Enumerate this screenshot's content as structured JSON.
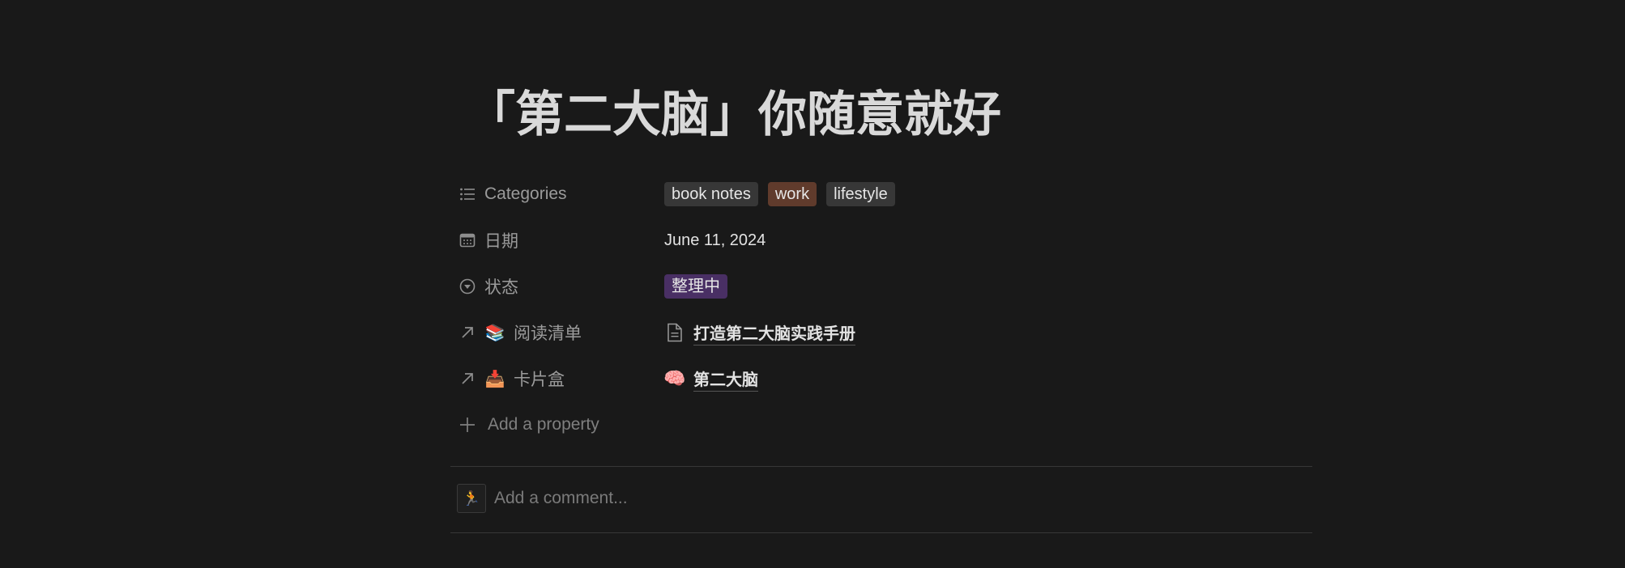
{
  "page": {
    "title": "「第二大脑」你随意就好"
  },
  "properties": {
    "categories": {
      "label": "Categories",
      "icon": "list-icon",
      "tags": [
        {
          "label": "book notes",
          "color": "#373737"
        },
        {
          "label": "work",
          "color": "#603b2c"
        },
        {
          "label": "lifestyle",
          "color": "#373737"
        }
      ]
    },
    "date": {
      "label": "日期",
      "icon": "calendar-icon",
      "value": "June 11, 2024"
    },
    "status": {
      "label": "状态",
      "icon": "status-icon",
      "value": "整理中",
      "color": "#492f64"
    },
    "reading_list": {
      "label": "阅读清单",
      "icon": "arrow-up-right-icon",
      "emoji": "📚",
      "relation_icon": "document-icon",
      "value": "打造第二大脑实践手册"
    },
    "card_box": {
      "label": "卡片盒",
      "icon": "arrow-up-right-icon",
      "emoji": "📥",
      "relation_emoji": "🧠",
      "value": "第二大脑"
    },
    "add_property": {
      "label": "Add a property",
      "icon": "plus-icon"
    }
  },
  "comment": {
    "avatar": "🏃",
    "placeholder": "Add a comment..."
  }
}
